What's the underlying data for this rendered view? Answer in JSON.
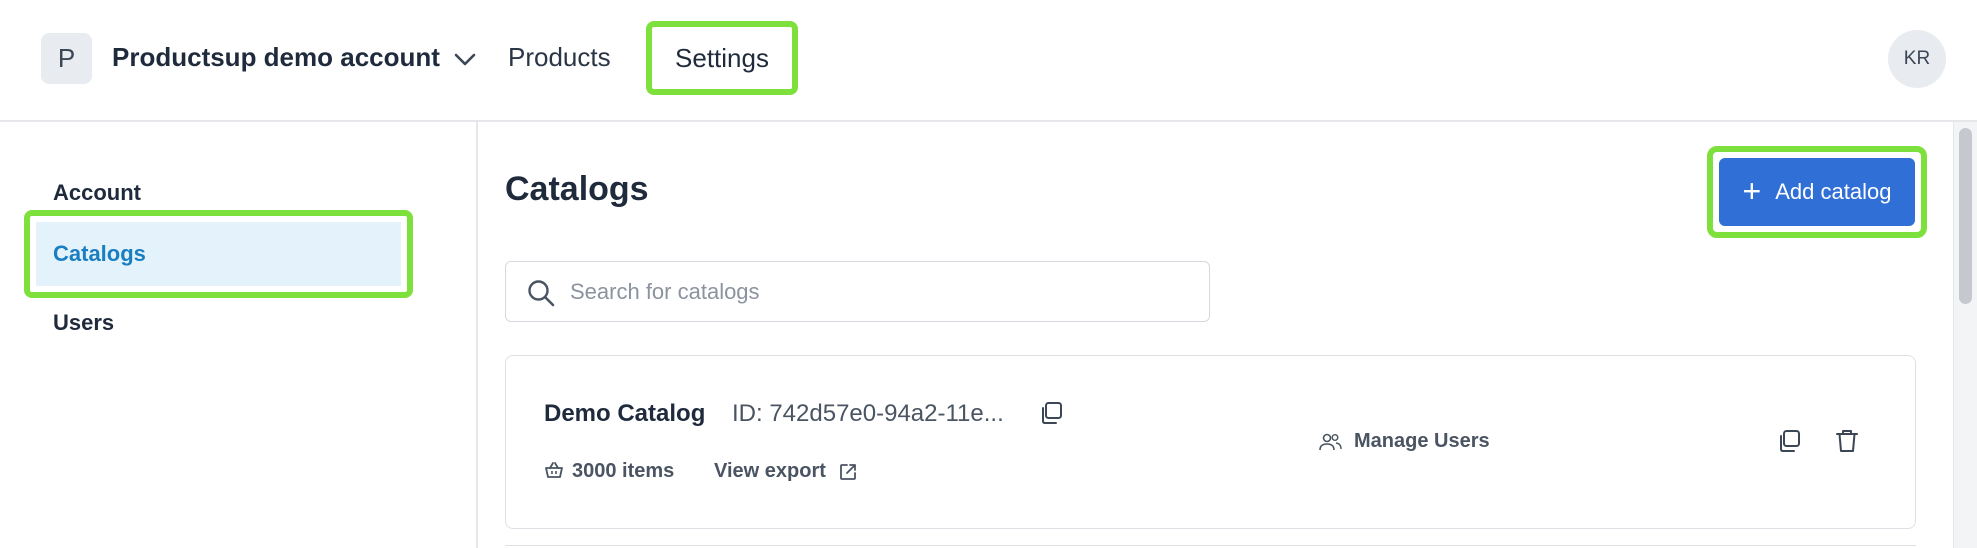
{
  "header": {
    "account_initial": "P",
    "account_name": "Productsup demo account",
    "nav": {
      "products": "Products",
      "settings": "Settings"
    },
    "user_initials": "KR"
  },
  "sidebar": {
    "items": [
      {
        "label": "Account"
      },
      {
        "label": "Catalogs",
        "active": true
      },
      {
        "label": "Users"
      }
    ]
  },
  "main": {
    "title": "Catalogs",
    "add_button_label": "Add catalog",
    "search": {
      "placeholder": "Search for catalogs",
      "value": ""
    },
    "catalogs": [
      {
        "name": "Demo Catalog",
        "id_text": "ID: 742d57e0-94a2-11e...",
        "items_text": "3000 items",
        "view_export_label": "View export",
        "manage_users_label": "Manage Users"
      }
    ]
  },
  "colors": {
    "accent": "#2f6fd6",
    "highlight_frame": "#7ee03d",
    "active_nav_bg": "#e4f2fb",
    "active_nav_text": "#1a7fc1"
  },
  "icons": {
    "account_chevron": "chevron-down-icon",
    "search": "search-icon",
    "copy_id": "copy-icon",
    "items": "basket-icon",
    "view_export": "external-link-icon",
    "manage_users": "users-icon",
    "duplicate": "duplicate-icon",
    "delete": "trash-icon",
    "add": "plus-icon"
  }
}
